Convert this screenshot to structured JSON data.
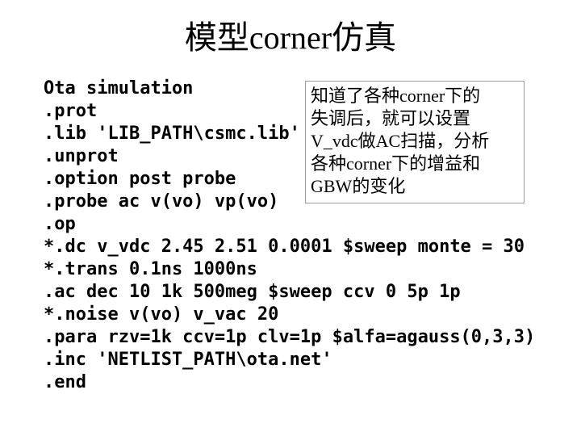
{
  "title": "模型corner仿真",
  "code": {
    "l01": "Ota simulation",
    "l02": ".prot",
    "l03": ".lib 'LIB_PATH\\csmc.lib'  tt",
    "l04": ".unprot",
    "l05": ".option post probe",
    "l06": ".probe ac v(vo) vp(vo)",
    "l07": ".op",
    "l08": "*.dc v_vdc 2.45 2.51 0.0001 $sweep monte = 30",
    "l09": "*.trans 0.1ns 1000ns",
    "l10": ".ac dec 10 1k 500meg $sweep ccv 0 5p 1p",
    "l11": "*.noise v(vo) v_vac 20",
    "l12": ".para rzv=1k ccv=1p clv=1p $alfa=agauss(0,3,3)",
    "l13": ".inc 'NETLIST_PATH\\ota.net'",
    "l14": ".end"
  },
  "note": {
    "l1": "知道了各种corner下的",
    "l2": "失调后，就可以设置",
    "l3": "V_vdc做AC扫描，分析",
    "l4": "各种corner下的增益和",
    "l5": "GBW的变化"
  }
}
